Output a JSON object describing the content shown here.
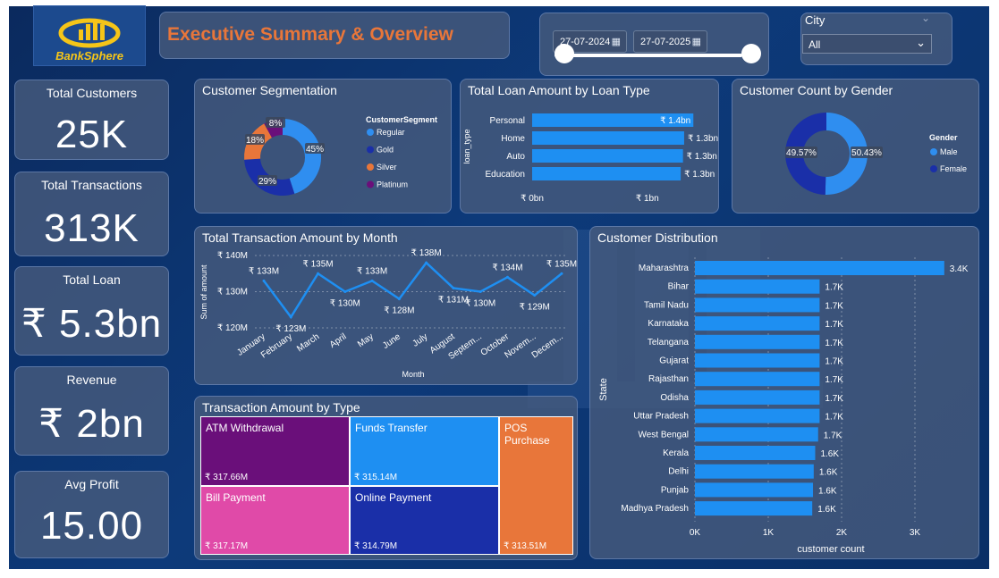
{
  "brand": {
    "name": "BankSphere"
  },
  "header": {
    "title": "Executive Summary & Overview"
  },
  "filters": {
    "date_start": "27-07-2024",
    "date_end": "27-07-2025",
    "city_label": "City",
    "city_value": "All"
  },
  "kpis": [
    {
      "title": "Total Customers",
      "value": "25K"
    },
    {
      "title": "Total Transactions",
      "value": "313K"
    },
    {
      "title": "Total Loan",
      "value": "₹ 5.3bn"
    },
    {
      "title": "Revenue",
      "value": "₹ 2bn"
    },
    {
      "title": "Avg Profit",
      "value": "15.00"
    }
  ],
  "colors": {
    "accent": "#1e8ff2",
    "title_orange": "#e8763a",
    "regular": "#2f8ef0",
    "gold": "#1a2fa8",
    "silver": "#e8763a",
    "platinum": "#6a0f7a",
    "male": "#2f8ef0",
    "female": "#1a2fa8"
  },
  "chart_data": [
    {
      "id": "segmentation",
      "type": "pie",
      "title": "Customer Segmentation",
      "legend_title": "CustomerSegment",
      "legend_position": "right",
      "labels": [
        "Regular",
        "Gold",
        "Silver",
        "Platinum"
      ],
      "values": [
        45,
        29,
        18,
        8
      ],
      "value_labels": [
        "45%",
        "29%",
        "18%",
        "8%"
      ]
    },
    {
      "id": "loan_type",
      "type": "bar",
      "orientation": "horizontal",
      "title": "Total Loan Amount by Loan Type",
      "ylabel": "loan_type",
      "categories": [
        "Personal",
        "Home",
        "Auto",
        "Education"
      ],
      "values": [
        1.4,
        1.32,
        1.31,
        1.29
      ],
      "value_labels": [
        "₹ 1.4bn",
        "₹ 1.3bn",
        "₹ 1.3bn",
        "₹ 1.3bn"
      ],
      "xlim": [
        0,
        1.6
      ],
      "xticks": [
        0,
        1
      ],
      "xtick_labels": [
        "₹ 0bn",
        "₹ 1bn"
      ]
    },
    {
      "id": "gender",
      "type": "pie",
      "title": "Customer Count by Gender",
      "legend_title": "Gender",
      "legend_position": "right",
      "labels": [
        "Male",
        "Female"
      ],
      "values": [
        50.43,
        49.57
      ],
      "value_labels": [
        "50.43%",
        "49.57%"
      ]
    },
    {
      "id": "monthly",
      "type": "line",
      "title": "Total Transaction Amount by Month",
      "xlabel": "Month",
      "ylabel": "Sum of amount",
      "categories": [
        "January",
        "February",
        "March",
        "April",
        "May",
        "June",
        "July",
        "August",
        "Septem...",
        "October",
        "Novem...",
        "Decem..."
      ],
      "values": [
        133,
        123,
        135,
        130,
        133,
        128,
        138,
        131,
        130,
        134,
        129,
        135
      ],
      "value_labels": [
        "₹ 133M",
        "₹ 123M",
        "₹ 135M",
        "₹ 130M",
        "₹ 133M",
        "₹ 128M",
        "₹ 138M",
        "₹ 131M",
        "₹ 130M",
        "₹ 134M",
        "₹ 129M",
        "₹ 135M"
      ],
      "ylim": [
        120,
        140
      ],
      "yticks": [
        120,
        130,
        140
      ],
      "ytick_labels": [
        "₹ 120M",
        "₹ 130M",
        "₹ 140M"
      ],
      "grid": true
    },
    {
      "id": "state",
      "type": "bar",
      "orientation": "horizontal",
      "title": "Customer Distribution",
      "xlabel": "customer count",
      "ylabel": "State",
      "categories": [
        "Maharashtra",
        "Bihar",
        "Tamil Nadu",
        "Karnataka",
        "Telangana",
        "Gujarat",
        "Rajasthan",
        "Odisha",
        "Uttar Pradesh",
        "West Bengal",
        "Kerala",
        "Delhi",
        "Punjab",
        "Madhya Pradesh"
      ],
      "values": [
        3.4,
        1.7,
        1.7,
        1.7,
        1.7,
        1.7,
        1.7,
        1.7,
        1.7,
        1.68,
        1.64,
        1.62,
        1.61,
        1.6
      ],
      "value_labels": [
        "3.4K",
        "1.7K",
        "1.7K",
        "1.7K",
        "1.7K",
        "1.7K",
        "1.7K",
        "1.7K",
        "1.7K",
        "1.7K",
        "1.6K",
        "1.6K",
        "1.6K",
        "1.6K"
      ],
      "xlim": [
        0,
        3.4
      ],
      "xticks": [
        0,
        1,
        2,
        3
      ],
      "xtick_labels": [
        "0K",
        "1K",
        "2K",
        "3K"
      ],
      "grid": true
    },
    {
      "id": "treemap",
      "type": "treemap",
      "title": "Transaction Amount by Type",
      "labels": [
        "ATM Withdrawal",
        "Funds Transfer",
        "POS Purchase",
        "Bill Payment",
        "Online Payment"
      ],
      "values": [
        317.66,
        315.14,
        313.51,
        317.17,
        314.79
      ],
      "value_labels": [
        "₹ 317.66M",
        "₹ 315.14M",
        "₹ 313.51M",
        "₹ 317.17M",
        "₹ 314.79M"
      ],
      "colors": [
        "#6a0f7a",
        "#1e8ff2",
        "#e8763a",
        "#e04aa8",
        "#1a2fa8"
      ]
    }
  ]
}
